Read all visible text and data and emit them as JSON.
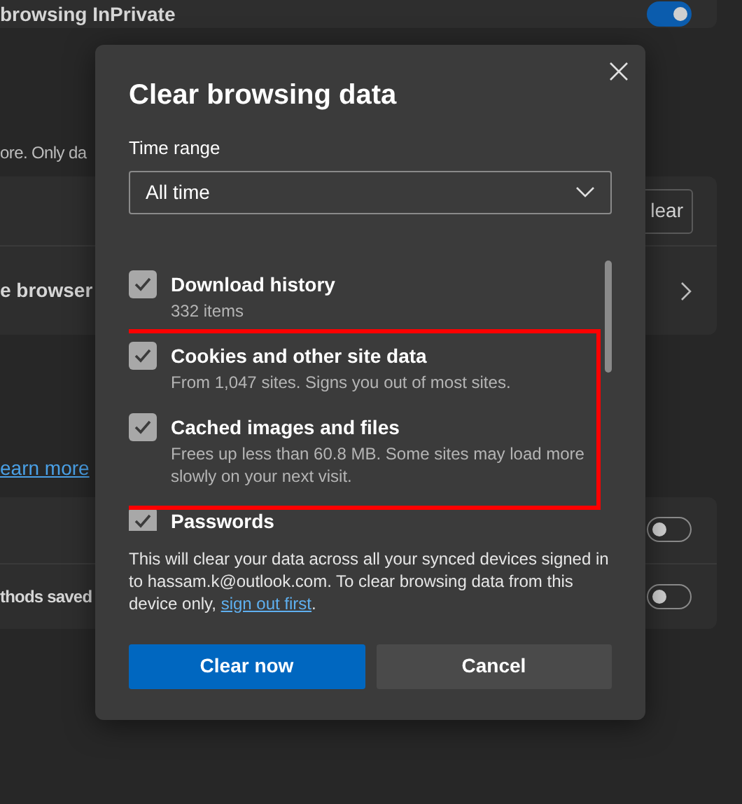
{
  "background": {
    "top_row": {
      "label": "browsing InPrivate",
      "on": true
    },
    "description": "ore. Only da",
    "clear_button": "lear",
    "browser_row": "e browser",
    "learn_more": "earn more",
    "toggle_rows": [
      {
        "label": "",
        "on": false
      },
      {
        "label": "thods saved",
        "on": false
      }
    ]
  },
  "dialog": {
    "title": "Clear browsing data",
    "time_range_label": "Time range",
    "time_range_value": "All time",
    "items": [
      {
        "title": "Download history",
        "subtitle": "332 items",
        "checked": true
      },
      {
        "title": "Cookies and other site data",
        "subtitle": "From 1,047 sites. Signs you out of most sites.",
        "checked": true
      },
      {
        "title": "Cached images and files",
        "subtitle": "Frees up less than 60.8 MB. Some sites may load more slowly on your next visit.",
        "checked": true
      },
      {
        "title": "Passwords",
        "checked": true
      }
    ],
    "notice": "This will clear your data across all your synced devices signed in to hassam.k@outlook.com. To clear browsing data from this device only, ",
    "notice_link": "sign out first",
    "notice_end": ".",
    "buttons": [
      {
        "label": "Clear now",
        "kind": "primary"
      },
      {
        "label": "Cancel",
        "kind": "secondary"
      }
    ]
  }
}
